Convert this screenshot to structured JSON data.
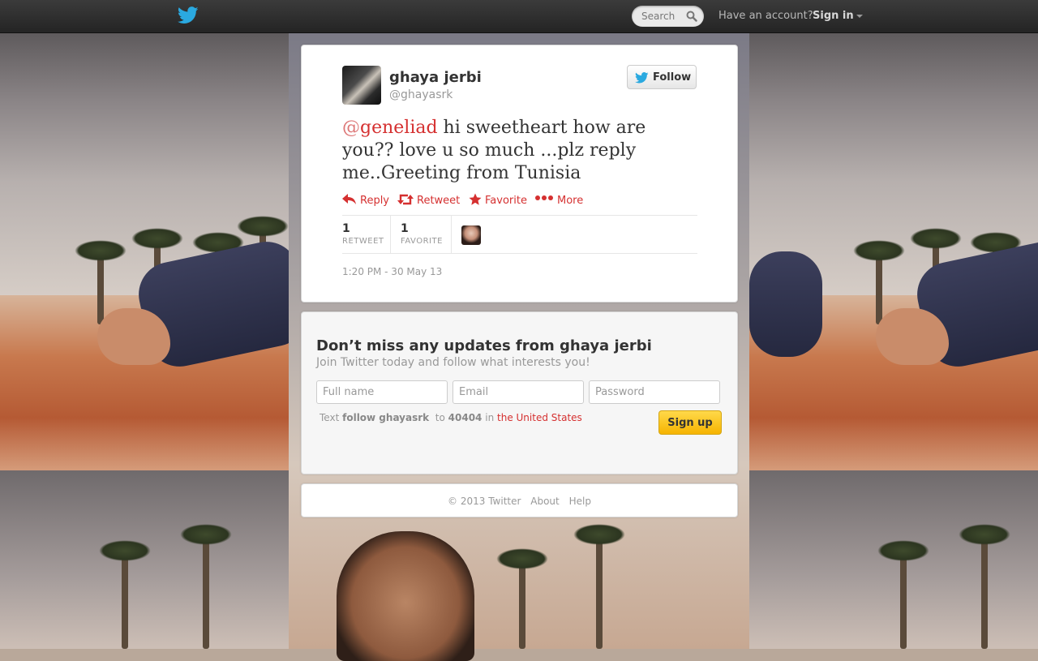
{
  "topbar": {
    "search_placeholder": "Search",
    "have_account": "Have an account?",
    "sign_in": "Sign in"
  },
  "tweet": {
    "author": {
      "name": "ghaya jerbi",
      "handle": "@ghayasrk"
    },
    "follow_label": "Follow",
    "text": {
      "mention_at": "@",
      "mention_user": "geneliad",
      "body": " hi sweetheart how are you?? love u so much ...plz reply me..Greeting from Tunisia"
    },
    "actions": {
      "reply": "Reply",
      "retweet": "Retweet",
      "favorite": "Favorite",
      "more": "More"
    },
    "stats": {
      "retweets": {
        "count": "1",
        "label": "RETWEET"
      },
      "favorites": {
        "count": "1",
        "label": "FAVORITE"
      }
    },
    "timestamp": "1:20 PM - 30 May 13"
  },
  "signup": {
    "title": "Don’t miss any updates from ghaya jerbi",
    "subtitle": "Join Twitter today and follow what interests you!",
    "fields": {
      "full_name": "Full name",
      "email": "Email",
      "password": "Password"
    },
    "sms": {
      "text_prefix": "Text",
      "command": "follow ghayasrk",
      "to": "to",
      "number": "40404",
      "in": "in",
      "country": "the United States"
    },
    "button": "Sign up"
  },
  "footer": {
    "copyright": "© 2013 Twitter",
    "about": "About",
    "help": "Help"
  },
  "colors": {
    "accent_red": "#d53030",
    "topbar": "#2e2e2e",
    "twitter_blue": "#2aa9e0",
    "signup_yellow": "#f6b400"
  },
  "icons": {
    "logo": "twitter-bird-icon",
    "search": "search-icon",
    "reply": "reply-icon",
    "retweet": "retweet-icon",
    "favorite": "star-icon",
    "more": "more-dots-icon"
  }
}
